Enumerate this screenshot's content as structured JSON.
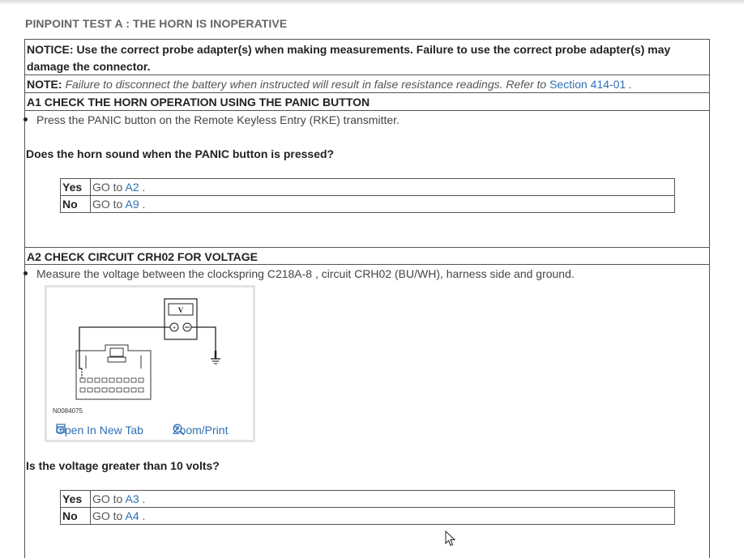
{
  "title": "PINPOINT TEST A : THE HORN IS INOPERATIVE",
  "notice": "NOTICE: Use the correct probe adapter(s) when making measurements. Failure to use the correct probe adapter(s) may damage the connector.",
  "note": {
    "label": "NOTE:",
    "text": "Failure to disconnect the battery when instructed will result in false resistance readings. Refer to",
    "link": "Section 414-01",
    "end": "."
  },
  "steps": [
    {
      "heading": "A1  CHECK THE HORN OPERATION USING THE PANIC BUTTON",
      "instruction": "Press the PANIC button on the Remote Keyless Entry (RKE) transmitter.",
      "question": "Does the horn sound when the PANIC button is pressed?",
      "answers": [
        {
          "key": "Yes",
          "goto": "GO to",
          "target": "A2",
          "end": "."
        },
        {
          "key": "No",
          "goto": "GO to",
          "target": "A9",
          "end": "."
        }
      ]
    },
    {
      "heading": "A2  CHECK CIRCUIT CRH02 FOR VOLTAGE",
      "instruction": "Measure the voltage between the clockspring C218A-8 , circuit CRH02 (BU/WH), harness side and ground.",
      "figure": {
        "code": "N0084075",
        "meter_label": "V",
        "open_tab": "Open In New Tab",
        "zoom": "Zoom/Print"
      },
      "question": "Is the voltage greater than 10 volts?",
      "answers": [
        {
          "key": "Yes",
          "goto": "GO to",
          "target": "A3",
          "end": "."
        },
        {
          "key": "No",
          "goto": "GO to",
          "target": "A4",
          "end": "."
        }
      ]
    }
  ],
  "colors": {
    "link": "#2e6fb5",
    "border": "#555555",
    "title": "#666666"
  }
}
